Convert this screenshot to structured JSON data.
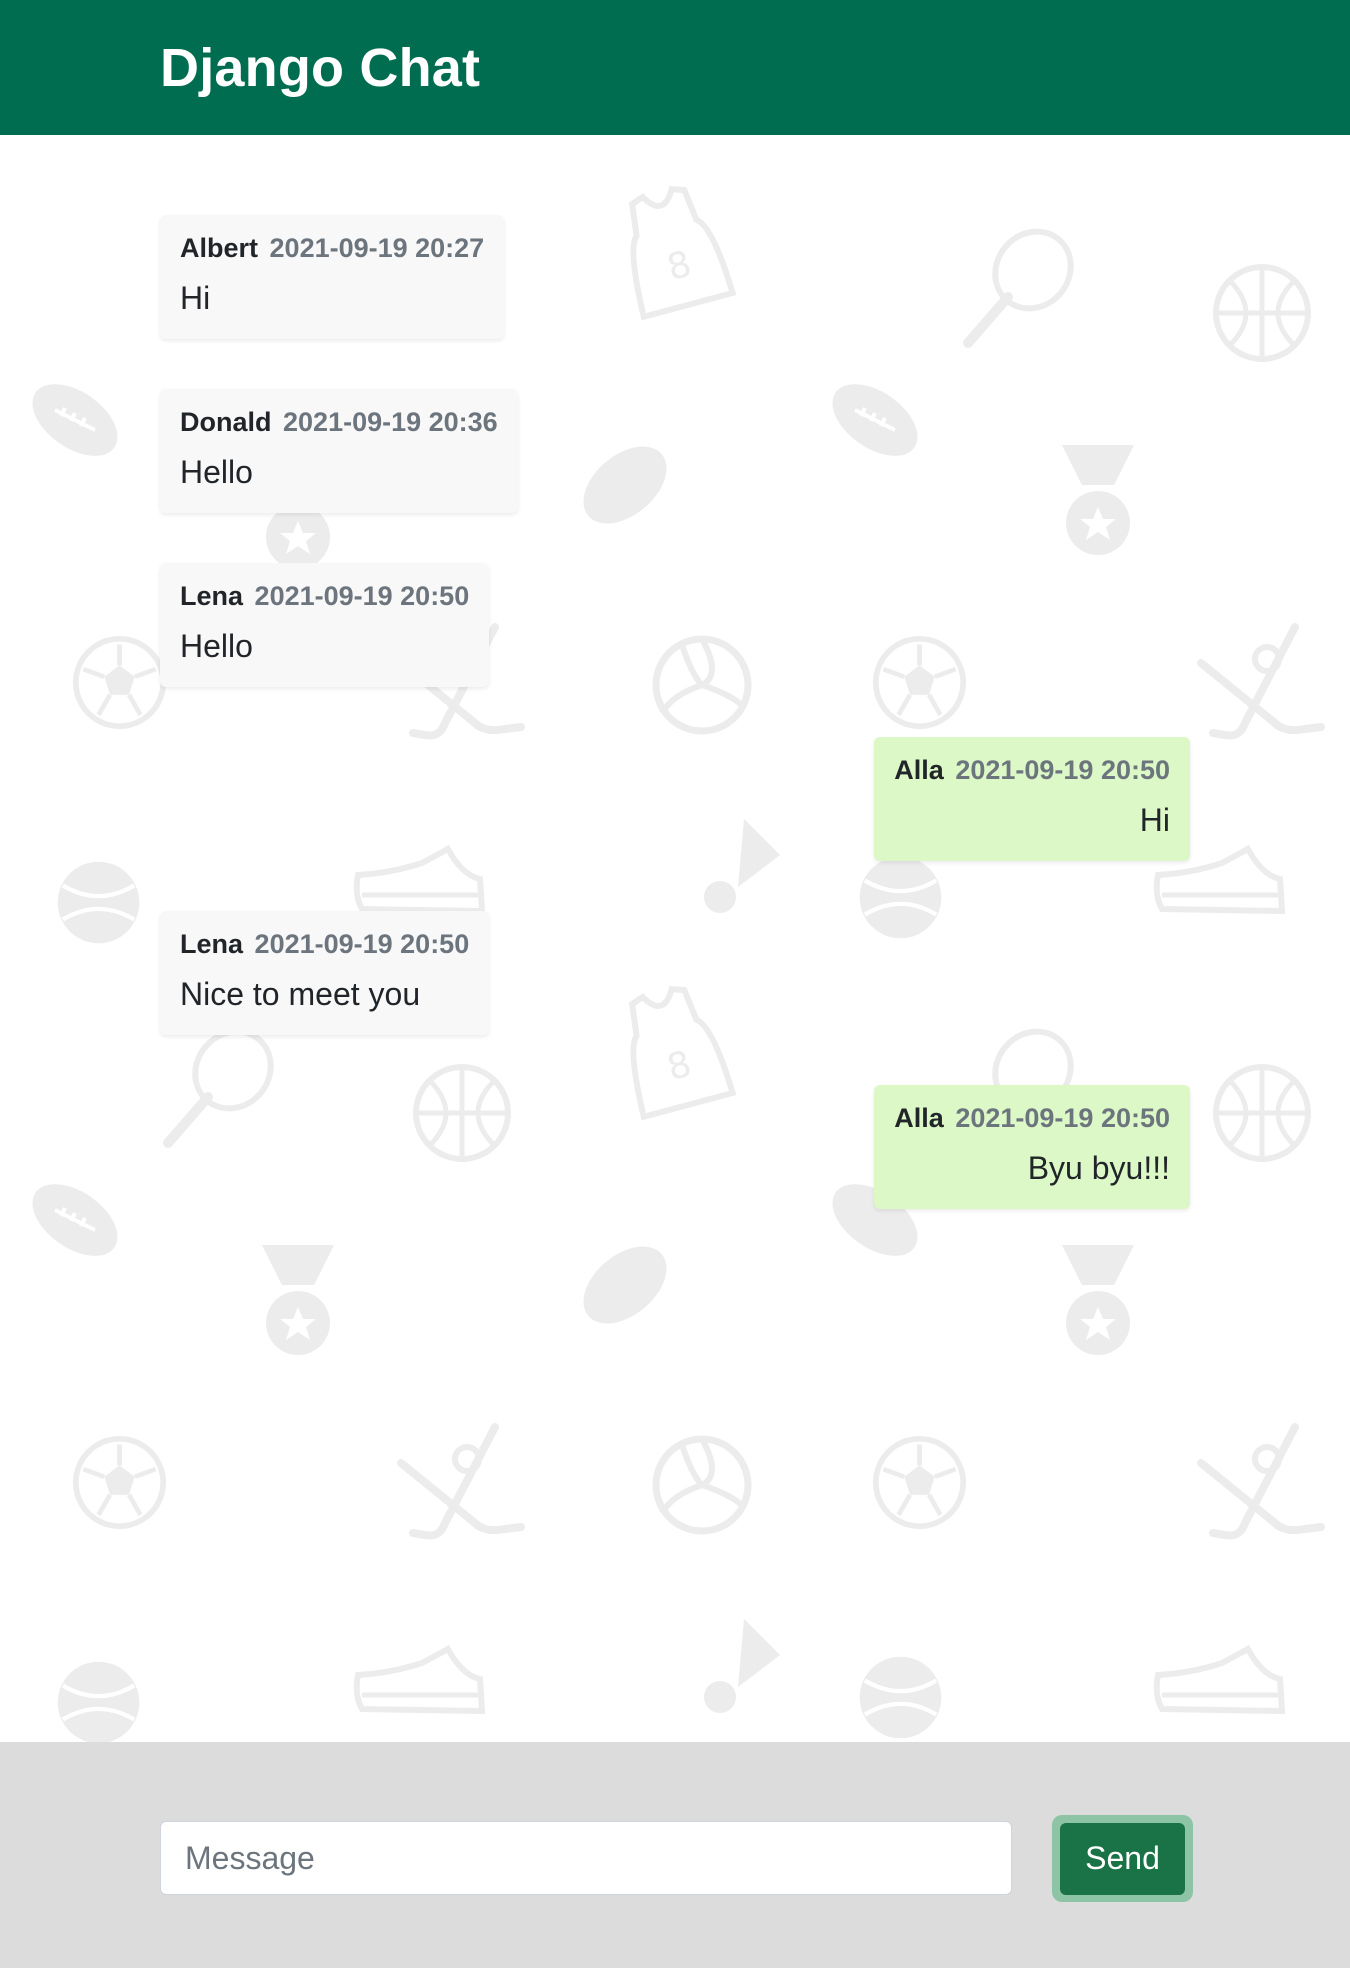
{
  "header": {
    "title": "Django Chat"
  },
  "messages": [
    {
      "author": "Albert",
      "time": "2021-09-19 20:27",
      "text": "Hi",
      "side": "incoming"
    },
    {
      "author": "Donald",
      "time": "2021-09-19 20:36",
      "text": "Hello",
      "side": "incoming"
    },
    {
      "author": "Lena",
      "time": "2021-09-19 20:50",
      "text": "Hello",
      "side": "incoming"
    },
    {
      "author": "Alla",
      "time": "2021-09-19 20:50",
      "text": "Hi",
      "side": "outgoing"
    },
    {
      "author": "Lena",
      "time": "2021-09-19 20:50",
      "text": "Nice to meet you",
      "side": "incoming"
    },
    {
      "author": "Alla",
      "time": "2021-09-19 20:50",
      "text": "Byu byu!!!",
      "side": "outgoing"
    }
  ],
  "composer": {
    "placeholder": "Message",
    "value": "",
    "send_label": "Send"
  },
  "colors": {
    "brand": "#006d50",
    "incoming_bubble": "#f8f8f8",
    "outgoing_bubble": "#dcf8c6",
    "send_button": "#197346",
    "footer_bg": "#dcdcdc"
  },
  "background_pattern_icons": [
    "basketball-jersey-icon",
    "tennis-racket-icon",
    "basketball-icon",
    "football-icon",
    "hockey-puck-icon",
    "medal-icon",
    "soccer-ball-icon",
    "volleyball-icon",
    "hockey-stick-icon",
    "tennis-ball-icon",
    "sneaker-icon",
    "shuttlecock-icon"
  ]
}
